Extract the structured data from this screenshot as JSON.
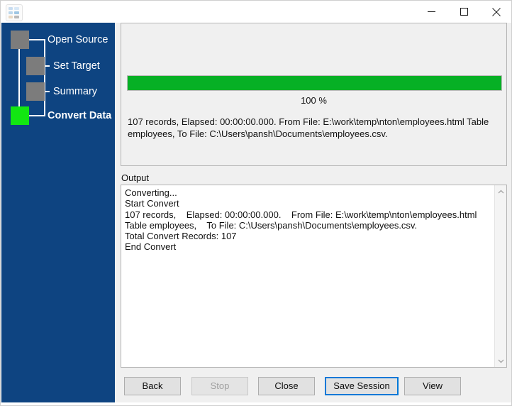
{
  "window": {
    "title": "",
    "icon": "app-grid-icon",
    "controls": {
      "minimize": "minimize-icon",
      "maximize": "maximize-icon",
      "close": "close-icon"
    }
  },
  "colors": {
    "sidebar_blue": "#0E4481",
    "step_inactive": "#7c7c7c",
    "step_active_green": "#12E712",
    "progress_green": "#06B025",
    "focus_blue": "#0078D7",
    "panel_gray": "#f0f0f0"
  },
  "sidebar": {
    "steps": [
      {
        "label": "Open Source",
        "state": "inactive"
      },
      {
        "label": "Set Target",
        "state": "inactive"
      },
      {
        "label": "Summary",
        "state": "inactive"
      },
      {
        "label": "Convert Data",
        "state": "active"
      }
    ]
  },
  "progress": {
    "percent": 100,
    "percent_label": "100 %",
    "status_line_1": "107 records,    Elapsed: 00:00:00.000.    From File: E:\\work\\temp\\nton\\employees.html Table employees,",
    "status_line_2": "To File: C:\\Users\\pansh\\Documents\\employees.csv."
  },
  "output": {
    "label": "Output",
    "log": "Converting...\nStart Convert\n107 records,    Elapsed: 00:00:00.000.    From File: E:\\work\\temp\\nton\\employees.html Table employees,    To File: C:\\Users\\pansh\\Documents\\employees.csv.\nTotal Convert Records: 107\nEnd Convert",
    "scrollbar": {
      "up_arrow": "chevron-up-icon",
      "down_arrow": "chevron-down-icon"
    }
  },
  "buttons": {
    "back": {
      "label": "Back",
      "state": "enabled"
    },
    "stop": {
      "label": "Stop",
      "state": "disabled"
    },
    "close": {
      "label": "Close",
      "state": "enabled"
    },
    "save_session": {
      "label": "Save Session",
      "state": "focused"
    },
    "view": {
      "label": "View",
      "state": "enabled"
    }
  }
}
